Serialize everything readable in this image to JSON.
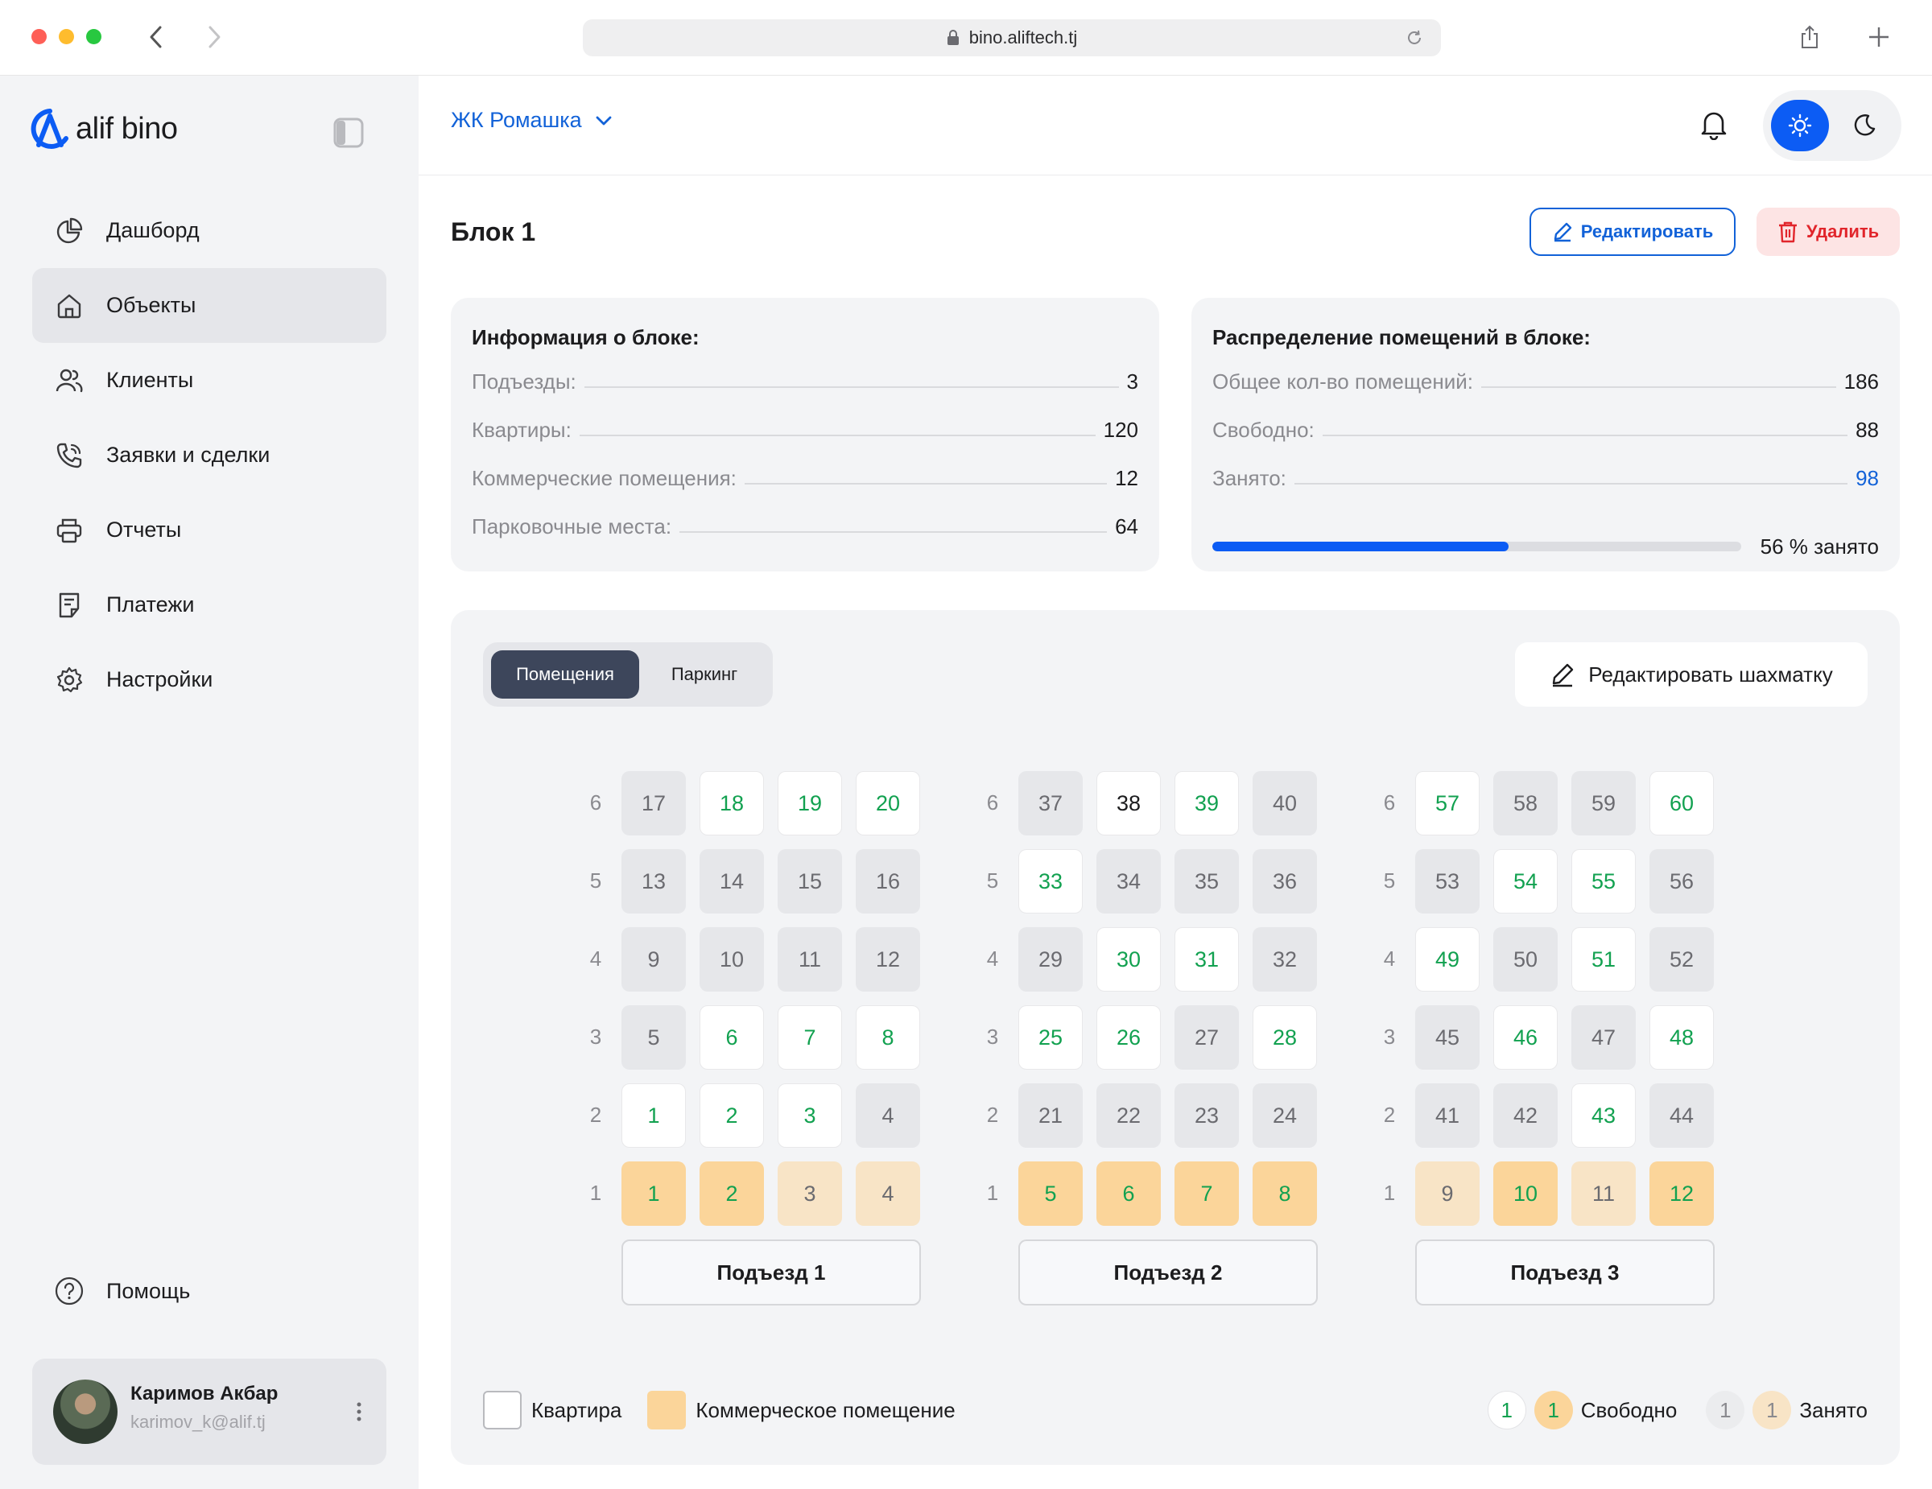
{
  "browser": {
    "url": "bino.aliftech.tj"
  },
  "sidebar": {
    "logo_text": "alif bino",
    "items": [
      {
        "label": "Дашборд",
        "icon": "pie-chart-icon",
        "active": false
      },
      {
        "label": "Объекты",
        "icon": "home-icon",
        "active": true
      },
      {
        "label": "Клиенты",
        "icon": "users-icon",
        "active": false
      },
      {
        "label": "Заявки и сделки",
        "icon": "phone-icon",
        "active": false
      },
      {
        "label": "Отчеты",
        "icon": "printer-icon",
        "active": false
      },
      {
        "label": "Платежи",
        "icon": "document-icon",
        "active": false
      },
      {
        "label": "Настройки",
        "icon": "gear-icon",
        "active": false
      }
    ],
    "help_label": "Помощь",
    "user": {
      "name": "Каримов Акбар",
      "email": "karimov_k@alif.tj"
    }
  },
  "header": {
    "project": "ЖК Ромашка"
  },
  "page": {
    "title": "Блок 1",
    "edit_label": "Редактировать",
    "delete_label": "Удалить"
  },
  "block_info": {
    "title": "Информация о блоке:",
    "rows": [
      {
        "label": "Подъезды:",
        "value": "3"
      },
      {
        "label": "Квартиры:",
        "value": "120"
      },
      {
        "label": "Коммерческие помещения:",
        "value": "12"
      },
      {
        "label": "Парковочные места:",
        "value": "64"
      }
    ]
  },
  "distribution": {
    "title": "Распределение помещений в блоке:",
    "rows": [
      {
        "label": "Общее кол-во помещений:",
        "value": "186"
      },
      {
        "label": "Свободно:",
        "value": "88"
      },
      {
        "label": "Занято:",
        "value": "98"
      }
    ],
    "occupied_percent": 56,
    "progress_label": "56 % занято"
  },
  "chessboard": {
    "tabs": [
      "Помещения",
      "Паркинг"
    ],
    "active_tab": 0,
    "edit_label": "Редактировать шахматку",
    "floors": [
      "6",
      "5",
      "4",
      "3",
      "2",
      "1"
    ],
    "entrances": [
      {
        "label": "Подъезд 1",
        "rows": [
          [
            {
              "n": "17",
              "s": "occ"
            },
            {
              "n": "18",
              "s": "free"
            },
            {
              "n": "19",
              "s": "free"
            },
            {
              "n": "20",
              "s": "free"
            }
          ],
          [
            {
              "n": "13",
              "s": "occ"
            },
            {
              "n": "14",
              "s": "occ"
            },
            {
              "n": "15",
              "s": "occ"
            },
            {
              "n": "16",
              "s": "occ"
            }
          ],
          [
            {
              "n": "9",
              "s": "occ"
            },
            {
              "n": "10",
              "s": "occ"
            },
            {
              "n": "11",
              "s": "occ"
            },
            {
              "n": "12",
              "s": "occ"
            }
          ],
          [
            {
              "n": "5",
              "s": "occ"
            },
            {
              "n": "6",
              "s": "free"
            },
            {
              "n": "7",
              "s": "free"
            },
            {
              "n": "8",
              "s": "free"
            }
          ],
          [
            {
              "n": "1",
              "s": "free"
            },
            {
              "n": "2",
              "s": "free"
            },
            {
              "n": "3",
              "s": "free"
            },
            {
              "n": "4",
              "s": "occ"
            }
          ],
          [
            {
              "n": "1",
              "s": "com-free"
            },
            {
              "n": "2",
              "s": "com-free"
            },
            {
              "n": "3",
              "s": "com-occ"
            },
            {
              "n": "4",
              "s": "com-occ"
            }
          ]
        ]
      },
      {
        "label": "Подъезд 2",
        "rows": [
          [
            {
              "n": "37",
              "s": "occ"
            },
            {
              "n": "38",
              "s": "free-dark"
            },
            {
              "n": "39",
              "s": "free"
            },
            {
              "n": "40",
              "s": "occ"
            }
          ],
          [
            {
              "n": "33",
              "s": "free"
            },
            {
              "n": "34",
              "s": "occ"
            },
            {
              "n": "35",
              "s": "occ"
            },
            {
              "n": "36",
              "s": "occ"
            }
          ],
          [
            {
              "n": "29",
              "s": "occ"
            },
            {
              "n": "30",
              "s": "free"
            },
            {
              "n": "31",
              "s": "free"
            },
            {
              "n": "32",
              "s": "occ"
            }
          ],
          [
            {
              "n": "25",
              "s": "free"
            },
            {
              "n": "26",
              "s": "free"
            },
            {
              "n": "27",
              "s": "occ"
            },
            {
              "n": "28",
              "s": "free"
            }
          ],
          [
            {
              "n": "21",
              "s": "occ"
            },
            {
              "n": "22",
              "s": "occ"
            },
            {
              "n": "23",
              "s": "occ"
            },
            {
              "n": "24",
              "s": "occ"
            }
          ],
          [
            {
              "n": "5",
              "s": "com-free"
            },
            {
              "n": "6",
              "s": "com-free"
            },
            {
              "n": "7",
              "s": "com-free"
            },
            {
              "n": "8",
              "s": "com-free"
            }
          ]
        ]
      },
      {
        "label": "Подъезд 3",
        "rows": [
          [
            {
              "n": "57",
              "s": "free"
            },
            {
              "n": "58",
              "s": "occ"
            },
            {
              "n": "59",
              "s": "occ"
            },
            {
              "n": "60",
              "s": "free"
            }
          ],
          [
            {
              "n": "53",
              "s": "occ"
            },
            {
              "n": "54",
              "s": "free"
            },
            {
              "n": "55",
              "s": "free"
            },
            {
              "n": "56",
              "s": "occ"
            }
          ],
          [
            {
              "n": "49",
              "s": "free"
            },
            {
              "n": "50",
              "s": "occ"
            },
            {
              "n": "51",
              "s": "free"
            },
            {
              "n": "52",
              "s": "occ"
            }
          ],
          [
            {
              "n": "45",
              "s": "occ"
            },
            {
              "n": "46",
              "s": "free"
            },
            {
              "n": "47",
              "s": "occ"
            },
            {
              "n": "48",
              "s": "free"
            }
          ],
          [
            {
              "n": "41",
              "s": "occ"
            },
            {
              "n": "42",
              "s": "occ"
            },
            {
              "n": "43",
              "s": "free"
            },
            {
              "n": "44",
              "s": "occ"
            }
          ],
          [
            {
              "n": "9",
              "s": "com-occ"
            },
            {
              "n": "10",
              "s": "com-free"
            },
            {
              "n": "11",
              "s": "com-occ"
            },
            {
              "n": "12",
              "s": "com-free"
            }
          ]
        ]
      }
    ],
    "legend": {
      "apartment": "Квартира",
      "commercial": "Коммерческое помещение",
      "free": "Свободно",
      "occupied": "Занято",
      "sample_number": "1"
    }
  },
  "colors": {
    "accent": "#1262d8",
    "primary_blue": "#0c5cf4",
    "free_green": "#12a150",
    "commercial": "#fbd59a",
    "danger": "#e1252b"
  }
}
